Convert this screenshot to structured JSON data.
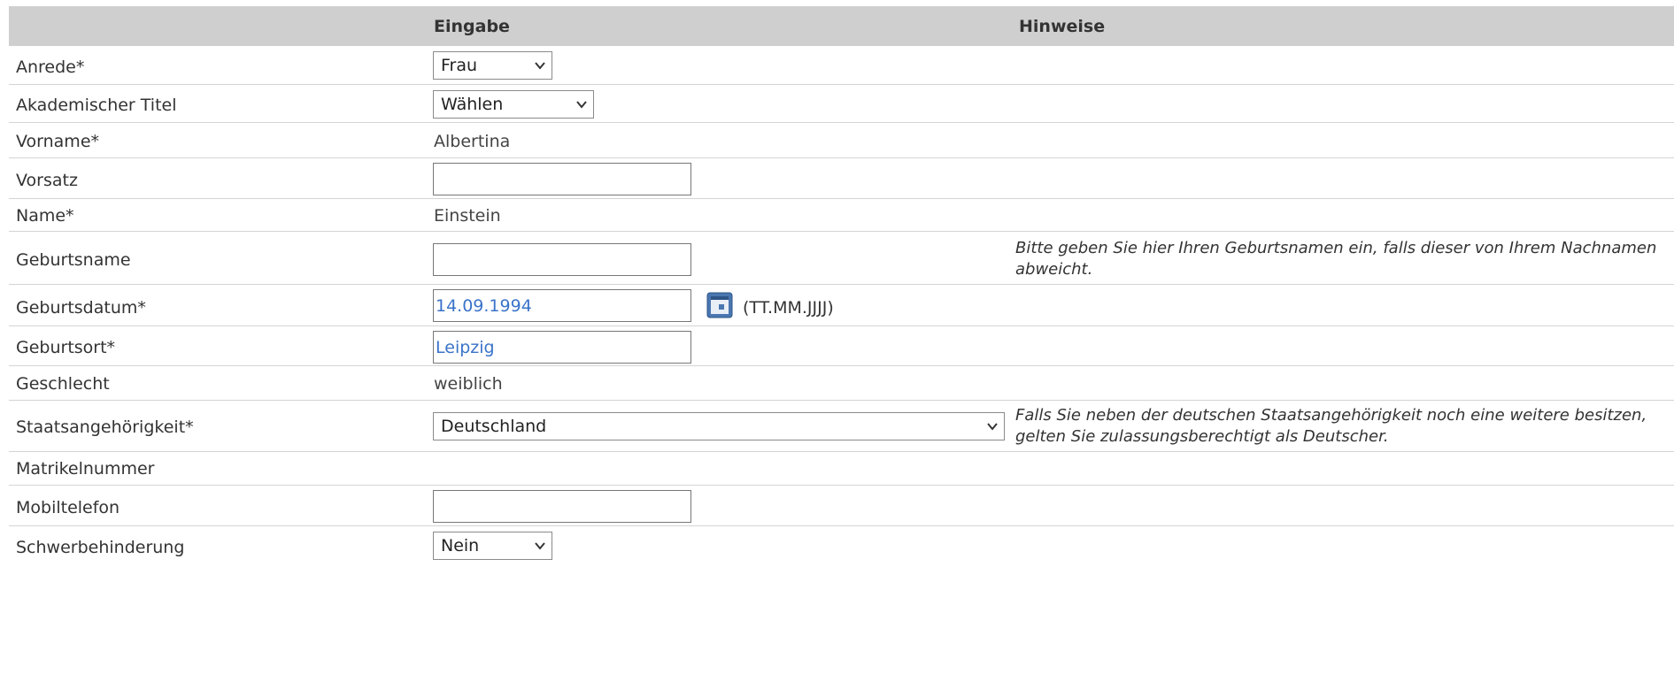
{
  "header": {
    "input_col": "Eingabe",
    "hint_col": "Hinweise"
  },
  "rows": [
    {
      "label": "Anrede*",
      "control": "select",
      "value": "Frau"
    },
    {
      "label": "Akademischer Titel",
      "control": "select",
      "value": "Wählen"
    },
    {
      "label": "Vorname*",
      "control": "static",
      "value": "Albertina"
    },
    {
      "label": "Vorsatz",
      "control": "text",
      "value": ""
    },
    {
      "label": "Name*",
      "control": "static",
      "value": "Einstein"
    },
    {
      "label": "Geburtsname",
      "control": "text",
      "value": "",
      "hint": "Bitte geben Sie hier Ihren Geburtsnamen ein, falls dieser von Ihrem Nachnamen abweicht."
    },
    {
      "label": "Geburtsdatum*",
      "control": "date",
      "value": "14.09.1994",
      "format": "(TT.MM.JJJJ)"
    },
    {
      "label": "Geburtsort*",
      "control": "text",
      "value": "Leipzig"
    },
    {
      "label": "Geschlecht",
      "control": "static",
      "value": "weiblich"
    },
    {
      "label": "Staatsangehörigkeit*",
      "control": "select",
      "value": "Deutschland",
      "hint": "Falls Sie neben der deutschen Staatsangehörigkeit noch eine weitere besitzen, gelten Sie zulassungsberechtigt als Deutscher."
    },
    {
      "label": "Matrikelnummer",
      "control": "none",
      "value": ""
    },
    {
      "label": "Mobiltelefon",
      "control": "text",
      "value": ""
    },
    {
      "label": "Schwerbehinderung",
      "control": "select",
      "value": "Nein"
    }
  ],
  "icons": {
    "dropdown": "chevron-down-icon",
    "calendar": "calendar-icon"
  },
  "colors": {
    "header_bg": "#cfcfcf",
    "input_text": "#3a73c9",
    "row_border": "#d4d4d4"
  }
}
